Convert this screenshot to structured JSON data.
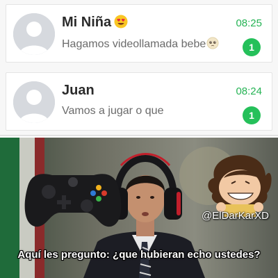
{
  "chats": [
    {
      "name": "Mi Niña",
      "name_emoji": "heart-eyes-emoji",
      "message": "Hagamos videollamada bebe",
      "message_emoji": "pleading-face-emoji",
      "time": "08:25",
      "unread": "1"
    },
    {
      "name": "Juan",
      "message": "Vamos a jugar o que",
      "time": "08:24",
      "unread": "1"
    }
  ],
  "meme": {
    "watermark": "@ElDarKarXD",
    "caption": "Aquí les pregunto: ¿que hubieran echo ustedes?",
    "icons": [
      "game-controller-icon",
      "gaming-headset-icon",
      "cartoon-avatar-icon"
    ]
  },
  "colors": {
    "time_green": "#25b354",
    "badge_green": "#25c05a",
    "avatar_bg": "#d6d9de"
  }
}
